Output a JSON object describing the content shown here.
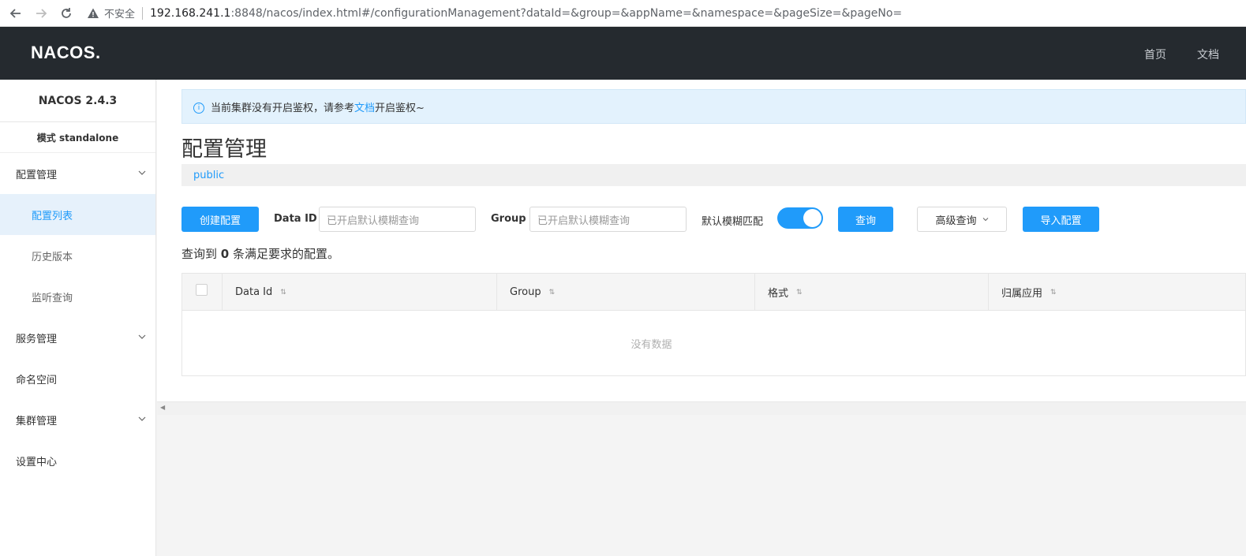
{
  "browser": {
    "insecure_label": "不安全",
    "url_host": "192.168.241.1",
    "url_rest": ":8848/nacos/index.html#/configurationManagement?dataId=&group=&appName=&namespace=&pageSize=&pageNo="
  },
  "header": {
    "logo": "NACOS.",
    "nav": [
      "首页",
      "文档"
    ]
  },
  "sidebar": {
    "version": "NACOS 2.4.3",
    "mode": "模式 standalone",
    "items": [
      {
        "label": "配置管理",
        "expandable": true
      },
      {
        "label": "配置列表",
        "sub": true,
        "active": true
      },
      {
        "label": "历史版本",
        "sub": true
      },
      {
        "label": "监听查询",
        "sub": true
      },
      {
        "label": "服务管理",
        "expandable": true
      },
      {
        "label": "命名空间"
      },
      {
        "label": "集群管理",
        "expandable": true
      },
      {
        "label": "设置中心"
      }
    ]
  },
  "notice": {
    "text_before": "当前集群没有开启鉴权，请参考",
    "link": "文档",
    "text_after": "开启鉴权~"
  },
  "page_title": "配置管理",
  "namespace": "public",
  "toolbar": {
    "create_label": "创建配置",
    "dataid_label": "Data ID",
    "dataid_placeholder": "已开启默认模糊查询",
    "group_label": "Group",
    "group_placeholder": "已开启默认模糊查询",
    "fuzzy_label": "默认模糊匹配",
    "fuzzy_on": true,
    "query_label": "查询",
    "advanced_label": "高级查询",
    "import_label": "导入配置"
  },
  "result": {
    "prefix": "查询到",
    "count": "0",
    "suffix": "条满足要求的配置。"
  },
  "table": {
    "columns": [
      "Data Id",
      "Group",
      "格式",
      "归属应用"
    ],
    "empty_text": "没有数据"
  },
  "colors": {
    "accent": "#209bfa",
    "header_bg": "#252a2f"
  }
}
